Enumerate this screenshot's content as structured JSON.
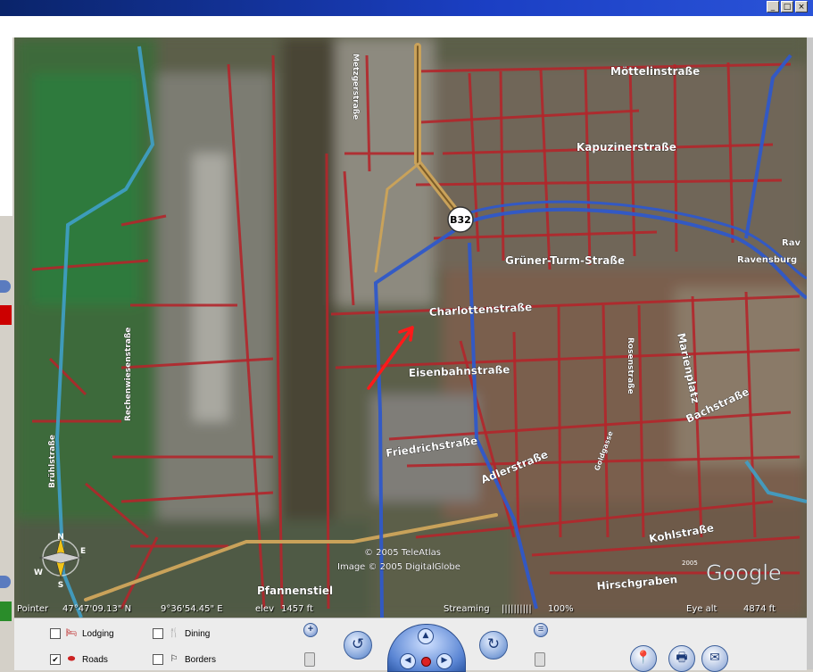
{
  "window": {
    "minimize_glyph": "_",
    "maximize_glyph": "□",
    "close_glyph": "×"
  },
  "map": {
    "street_labels": {
      "moettelinstrasse": "Möttelinstraße",
      "kapuzinerstrasse": "Kapuzinerstraße",
      "gruener_turm_strasse": "Grüner-Turm-Straße",
      "charlottenstrasse": "Charlottenstraße",
      "eisenbahnstrasse": "Eisenbahnstraße",
      "friedrichstrasse": "Friedrichstraße",
      "adlerstrasse": "Adlerstraße",
      "bachstrasse": "Bachstraße",
      "marienplatz": "Marienplatz",
      "rosenstrasse": "Rosenstraße",
      "goldgasse": "Goldgasse",
      "kohlstrasse": "Kohlstraße",
      "hirschgraben": "Hirschgraben",
      "pfannenstiel": "Pfannenstiel",
      "metzgerstrasse": "Metzgerstraße",
      "rechenwiesenstrasse": "Rechenwiesenstraße",
      "bruehlstrasse": "Brühlstraße",
      "ravensburg": "Ravensburg",
      "rav_fragment": "Rav"
    },
    "route_shield": "B32",
    "copyright_line1": "© 2005 TeleAtlas",
    "copyright_line2": "Image © 2005 DigitalGlobe",
    "google_logo": "Google",
    "google_year": "2005",
    "compass_n": "N",
    "compass_e": "E",
    "compass_s": "S",
    "compass_w": "W"
  },
  "status": {
    "pointer_label": "Pointer",
    "pointer_lat": "47°47'09.13\"  N",
    "pointer_lon": "9°36'54.45\"   E",
    "elev_label": "elev",
    "elev_value": "1457 ft",
    "streaming_label": "Streaming",
    "streaming_bar": "||||||||||",
    "streaming_percent": "100%",
    "eye_alt_label": "Eye  alt",
    "eye_alt_value": "4874 ft"
  },
  "layers": [
    {
      "label": "Lodging",
      "checked": "",
      "icon": "🛏"
    },
    {
      "label": "Dining",
      "checked": "",
      "icon": "🍴"
    },
    {
      "label": "Roads",
      "checked": "✔",
      "icon": "⬬"
    },
    {
      "label": "Borders",
      "checked": "",
      "icon": "⚐"
    }
  ],
  "nav": {
    "zoom_in": "+",
    "rotate_left": "↺",
    "rotate_right": "↻",
    "up": "▲",
    "left": "◀",
    "right": "▶",
    "tilt_up": "≡",
    "placemark": "📍",
    "print": "🖶",
    "email": "✉"
  },
  "colors": {
    "road_red": "#b3262b",
    "road_blue": "#2f58c9",
    "highway_tan": "#c9a25a",
    "river_blue": "#3fa0c8",
    "title_bar": "#0a246a",
    "direction_arrow": "#ff1a1a"
  }
}
